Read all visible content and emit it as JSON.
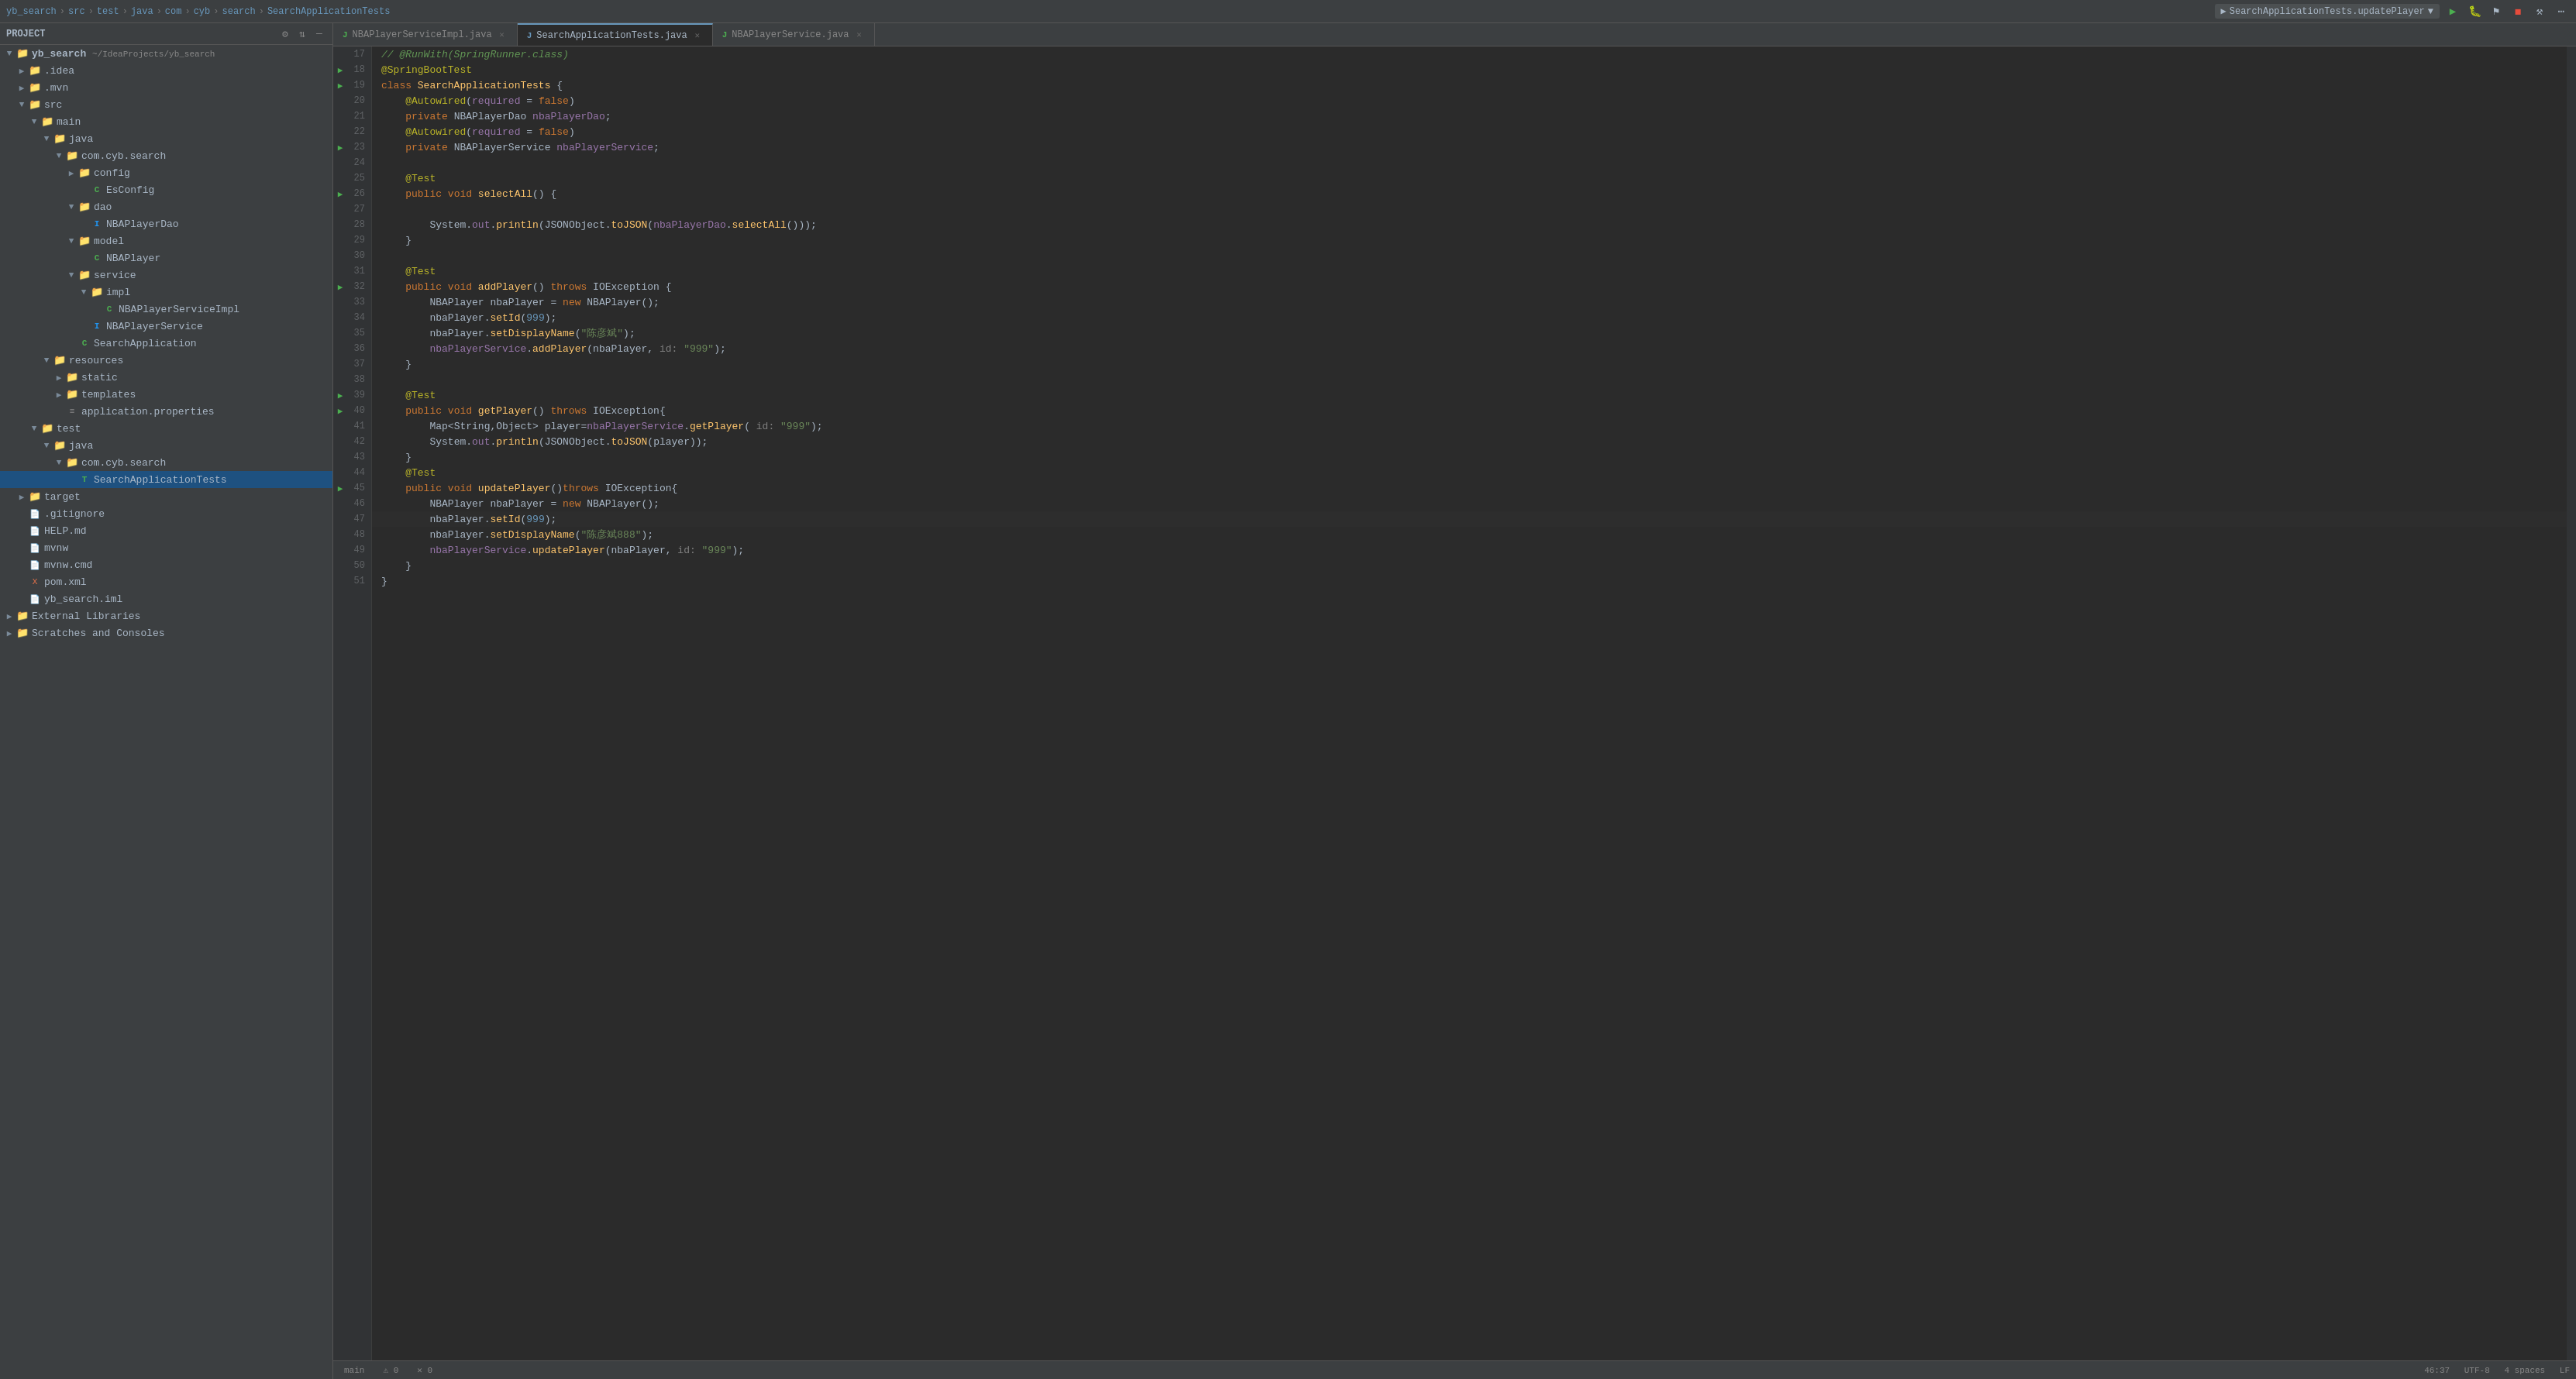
{
  "topbar": {
    "breadcrumb": [
      "yb_search",
      "src",
      "test",
      "java",
      "com",
      "cyb",
      "search",
      "SearchApplicationTests"
    ],
    "active_file": "updatePlayer",
    "run_config": "SearchApplicationTests.updatePlayer",
    "buttons": {
      "run": "▶",
      "debug": "⬛",
      "stop": "◼",
      "coverage": "⚑",
      "build": "⚒"
    }
  },
  "tabs": [
    {
      "id": "tab1",
      "icon": "J",
      "icon_color": "green",
      "label": "NBAPlayerServiceImpl.java",
      "closable": true
    },
    {
      "id": "tab2",
      "icon": "J",
      "icon_color": "blue",
      "label": "SearchApplicationTests.java",
      "closable": true,
      "active": true
    },
    {
      "id": "tab3",
      "icon": "J",
      "icon_color": "green",
      "label": "NBAPlayerService.java",
      "closable": true
    }
  ],
  "sidebar": {
    "title": "Project",
    "project_name": "yb_search",
    "project_path": "~/IdeaProjects/yb_search",
    "tree": [
      {
        "id": "yb_search",
        "level": 0,
        "arrow": "▼",
        "icon": "📁",
        "icon_type": "folder",
        "label": "yb_search",
        "suffix": "~/IdeaProjects/yb_search"
      },
      {
        "id": "idea",
        "level": 1,
        "arrow": "▶",
        "icon": "📁",
        "icon_type": "folder",
        "label": ".idea"
      },
      {
        "id": "mvn",
        "level": 1,
        "arrow": "▶",
        "icon": "📁",
        "icon_type": "folder",
        "label": ".mvn"
      },
      {
        "id": "src",
        "level": 1,
        "arrow": "▼",
        "icon": "📁",
        "icon_type": "folder",
        "label": "src"
      },
      {
        "id": "main",
        "level": 2,
        "arrow": "▼",
        "icon": "📁",
        "icon_type": "folder",
        "label": "main"
      },
      {
        "id": "java",
        "level": 3,
        "arrow": "▼",
        "icon": "📁",
        "icon_type": "folder",
        "label": "java"
      },
      {
        "id": "com_cyb_search",
        "level": 4,
        "arrow": "▼",
        "icon": "📁",
        "icon_type": "folder",
        "label": "com.cyb.search"
      },
      {
        "id": "config",
        "level": 5,
        "arrow": "▶",
        "icon": "📁",
        "icon_type": "folder",
        "label": "config"
      },
      {
        "id": "EsConfig",
        "level": 6,
        "arrow": "",
        "icon": "C",
        "icon_type": "java-class",
        "label": "EsConfig"
      },
      {
        "id": "dao",
        "level": 5,
        "arrow": "▼",
        "icon": "📁",
        "icon_type": "folder",
        "label": "dao"
      },
      {
        "id": "NBAPlayerDao",
        "level": 6,
        "arrow": "",
        "icon": "I",
        "icon_type": "java-interface",
        "label": "NBAPlayerDao"
      },
      {
        "id": "model",
        "level": 5,
        "arrow": "▼",
        "icon": "📁",
        "icon_type": "folder",
        "label": "model"
      },
      {
        "id": "NBAPlayer",
        "level": 6,
        "arrow": "",
        "icon": "C",
        "icon_type": "java-class",
        "label": "NBAPlayer"
      },
      {
        "id": "service",
        "level": 5,
        "arrow": "▼",
        "icon": "📁",
        "icon_type": "folder",
        "label": "service"
      },
      {
        "id": "impl",
        "level": 6,
        "arrow": "▼",
        "icon": "📁",
        "icon_type": "folder",
        "label": "impl"
      },
      {
        "id": "NBAPlayerServiceImpl",
        "level": 7,
        "arrow": "",
        "icon": "C",
        "icon_type": "java-class",
        "label": "NBAPlayerServiceImpl"
      },
      {
        "id": "NBAPlayerService",
        "level": 6,
        "arrow": "",
        "icon": "I",
        "icon_type": "java-interface",
        "label": "NBAPlayerService"
      },
      {
        "id": "SearchApplication",
        "level": 5,
        "arrow": "",
        "icon": "C",
        "icon_type": "java-class",
        "label": "SearchApplication"
      },
      {
        "id": "resources",
        "level": 3,
        "arrow": "▼",
        "icon": "📁",
        "icon_type": "folder",
        "label": "resources"
      },
      {
        "id": "static",
        "level": 4,
        "arrow": "▶",
        "icon": "📁",
        "icon_type": "folder",
        "label": "static"
      },
      {
        "id": "templates",
        "level": 4,
        "arrow": "▶",
        "icon": "📁",
        "icon_type": "folder",
        "label": "templates"
      },
      {
        "id": "application_properties",
        "level": 4,
        "arrow": "",
        "icon": "P",
        "icon_type": "properties",
        "label": "application.properties"
      },
      {
        "id": "test",
        "level": 2,
        "arrow": "▼",
        "icon": "📁",
        "icon_type": "folder",
        "label": "test"
      },
      {
        "id": "test_java",
        "level": 3,
        "arrow": "▼",
        "icon": "📁",
        "icon_type": "folder",
        "label": "java"
      },
      {
        "id": "test_com_cyb_search",
        "level": 4,
        "arrow": "▼",
        "icon": "📁",
        "icon_type": "folder",
        "label": "com.cyb.search"
      },
      {
        "id": "SearchApplicationTests",
        "level": 5,
        "arrow": "",
        "icon": "T",
        "icon_type": "java-test",
        "label": "SearchApplicationTests",
        "selected": true
      },
      {
        "id": "target",
        "level": 1,
        "arrow": "▶",
        "icon": "📁",
        "icon_type": "folder",
        "label": "target"
      },
      {
        "id": "gitignore",
        "level": 1,
        "arrow": "",
        "icon": "F",
        "icon_type": "file",
        "label": ".gitignore"
      },
      {
        "id": "HELP_md",
        "level": 1,
        "arrow": "",
        "icon": "F",
        "icon_type": "file",
        "label": "HELP.md"
      },
      {
        "id": "mvnw",
        "level": 1,
        "arrow": "",
        "icon": "F",
        "icon_type": "file",
        "label": "mvnw"
      },
      {
        "id": "mvnw_cmd",
        "level": 1,
        "arrow": "",
        "icon": "F",
        "icon_type": "file",
        "label": "mvnw.cmd"
      },
      {
        "id": "pom_xml",
        "level": 1,
        "arrow": "",
        "icon": "X",
        "icon_type": "xml",
        "label": "pom.xml"
      },
      {
        "id": "yb_search_iml",
        "level": 1,
        "arrow": "",
        "icon": "F",
        "icon_type": "file",
        "label": "yb_search.iml"
      },
      {
        "id": "external_libs",
        "level": 0,
        "arrow": "▶",
        "icon": "📁",
        "icon_type": "folder",
        "label": "External Libraries"
      },
      {
        "id": "scratches",
        "level": 0,
        "arrow": "▶",
        "icon": "📁",
        "icon_type": "folder",
        "label": "Scratches and Consoles"
      }
    ]
  },
  "code": {
    "lines": [
      {
        "num": 17,
        "gutter_icon": null,
        "content": "// @RunWith(SpringRunner.class)",
        "type": "comment"
      },
      {
        "num": 18,
        "gutter_icon": "run",
        "content": "@SpringBootTest",
        "type": "annotation"
      },
      {
        "num": 19,
        "gutter_icon": "run",
        "content": "class SearchApplicationTests {",
        "type": "code"
      },
      {
        "num": 20,
        "gutter_icon": null,
        "content": "    @Autowired(required = false)",
        "type": "annotation"
      },
      {
        "num": 21,
        "gutter_icon": null,
        "content": "    private NBAPlayerDao nbaPlayerDao;",
        "type": "code"
      },
      {
        "num": 22,
        "gutter_icon": null,
        "content": "    @Autowired(required = false)",
        "type": "annotation"
      },
      {
        "num": 23,
        "gutter_icon": "run",
        "content": "    private NBAPlayerService nbaPlayerService;",
        "type": "code"
      },
      {
        "num": 24,
        "gutter_icon": null,
        "content": "",
        "type": "empty"
      },
      {
        "num": 25,
        "gutter_icon": null,
        "content": "    @Test",
        "type": "annotation"
      },
      {
        "num": 26,
        "gutter_icon": "run",
        "content": "    public void selectAll() {",
        "type": "code"
      },
      {
        "num": 27,
        "gutter_icon": null,
        "content": "",
        "type": "empty"
      },
      {
        "num": 28,
        "gutter_icon": null,
        "content": "        System.out.println(JSONObject.toJSON(nbaPlayerDao.selectAll()));",
        "type": "code"
      },
      {
        "num": 29,
        "gutter_icon": null,
        "content": "    }",
        "type": "code"
      },
      {
        "num": 30,
        "gutter_icon": null,
        "content": "",
        "type": "empty"
      },
      {
        "num": 31,
        "gutter_icon": null,
        "content": "    @Test",
        "type": "annotation"
      },
      {
        "num": 32,
        "gutter_icon": "run",
        "content": "    public void addPlayer() throws IOException {",
        "type": "code"
      },
      {
        "num": 33,
        "gutter_icon": null,
        "content": "        NBAPlayer nbaPlayer = new NBAPlayer();",
        "type": "code"
      },
      {
        "num": 34,
        "gutter_icon": null,
        "content": "        nbaPlayer.setId(999);",
        "type": "code"
      },
      {
        "num": 35,
        "gutter_icon": null,
        "content": "        nbaPlayer.setDisplayName(\"陈彦斌\");",
        "type": "code"
      },
      {
        "num": 36,
        "gutter_icon": null,
        "content": "        nbaPlayerService.addPlayer(nbaPlayer, id: \"999\");",
        "type": "code"
      },
      {
        "num": 37,
        "gutter_icon": null,
        "content": "    }",
        "type": "code"
      },
      {
        "num": 38,
        "gutter_icon": null,
        "content": "",
        "type": "empty"
      },
      {
        "num": 39,
        "gutter_icon": "run",
        "content": "    @Test",
        "type": "annotation"
      },
      {
        "num": 40,
        "gutter_icon": "run",
        "content": "    public void getPlayer() throws IOException{",
        "type": "code"
      },
      {
        "num": 41,
        "gutter_icon": null,
        "content": "        Map<String,Object> player=nbaPlayerService.getPlayer( id: \"999\");",
        "type": "code"
      },
      {
        "num": 42,
        "gutter_icon": null,
        "content": "        System.out.println(JSONObject.toJSON(player));",
        "type": "code"
      },
      {
        "num": 43,
        "gutter_icon": null,
        "content": "    }",
        "type": "code"
      },
      {
        "num": 44,
        "gutter_icon": null,
        "content": "    @Test",
        "type": "annotation"
      },
      {
        "num": 45,
        "gutter_icon": "run",
        "content": "    public void updatePlayer()throws IOException{",
        "type": "code"
      },
      {
        "num": 46,
        "gutter_icon": null,
        "content": "        NBAPlayer nbaPlayer = new NBAPlayer();",
        "type": "code"
      },
      {
        "num": 47,
        "gutter_icon": null,
        "content": "        nbaPlayer.setId(999);|",
        "type": "code",
        "cursor": true
      },
      {
        "num": 48,
        "gutter_icon": null,
        "content": "        nbaPlayer.setDisplayName(\"陈彦斌888\");",
        "type": "code"
      },
      {
        "num": 49,
        "gutter_icon": null,
        "content": "        nbaPlayerService.updatePlayer(nbaPlayer, id: \"999\");",
        "type": "code"
      },
      {
        "num": 50,
        "gutter_icon": null,
        "content": "    }",
        "type": "code"
      },
      {
        "num": 51,
        "gutter_icon": null,
        "content": "}",
        "type": "code"
      }
    ]
  },
  "statusbar": {
    "line": "46",
    "col": "37",
    "encoding": "UTF-8",
    "line_separator": "LF",
    "indent": "4 spaces"
  }
}
